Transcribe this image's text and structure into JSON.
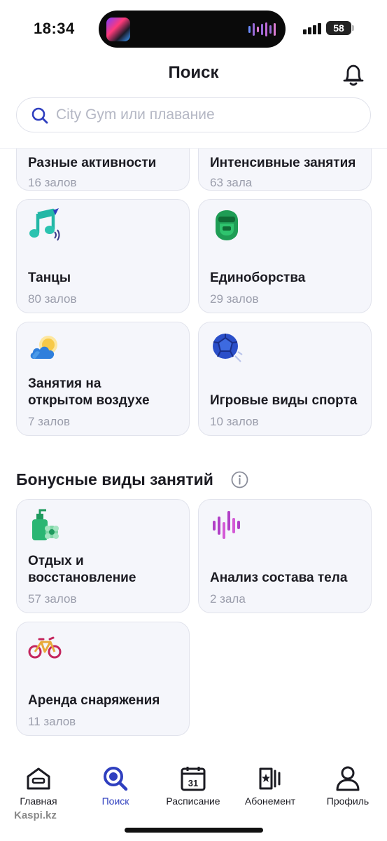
{
  "status_bar": {
    "time": "18:34",
    "battery": "58"
  },
  "header": {
    "title": "Поиск"
  },
  "search": {
    "placeholder": "City Gym или плавание",
    "value": ""
  },
  "categories": [
    {
      "title": "Разные активности",
      "count": "16 залов",
      "icon": "activities-icon"
    },
    {
      "title": "Интенсивные занятия",
      "count": "63 зала",
      "icon": "intensive-icon"
    },
    {
      "title": "Танцы",
      "count": "80 залов",
      "icon": "music-note-icon"
    },
    {
      "title": "Единоборства",
      "count": "29 залов",
      "icon": "boxing-helmet-icon"
    },
    {
      "title_lines": [
        "Занятия на",
        "открытом воздухе"
      ],
      "count": "7 залов",
      "icon": "sun-cloud-icon"
    },
    {
      "title": "Игровые виды спорта",
      "count": "10 залов",
      "icon": "ball-icon"
    }
  ],
  "bonus_section": {
    "title": "Бонусные виды занятий",
    "items": [
      {
        "title_lines": [
          "Отдых и",
          "восстановление"
        ],
        "count": "57 залов",
        "icon": "spa-bottle-icon"
      },
      {
        "title": "Анализ состава тела",
        "count": "2 зала",
        "icon": "waveform-icon"
      },
      {
        "title": "Аренда снаряжения",
        "count": "11 залов",
        "icon": "bicycle-icon"
      }
    ]
  },
  "tabbar": {
    "tabs": [
      {
        "label": "Главная",
        "icon": "home-icon",
        "active": false
      },
      {
        "label": "Поиск",
        "icon": "search-icon",
        "active": true
      },
      {
        "label": "Расписание",
        "icon": "calendar-icon",
        "calendar_day": "31",
        "active": false
      },
      {
        "label": "Абонемент",
        "icon": "membership-card-icon",
        "active": false
      },
      {
        "label": "Профиль",
        "icon": "profile-icon",
        "active": false
      }
    ]
  },
  "watermark": "Kaspi.kz",
  "colors": {
    "accent": "#2f3fbf",
    "card_bg": "#f5f6fb",
    "muted_text": "#9a9dab"
  }
}
